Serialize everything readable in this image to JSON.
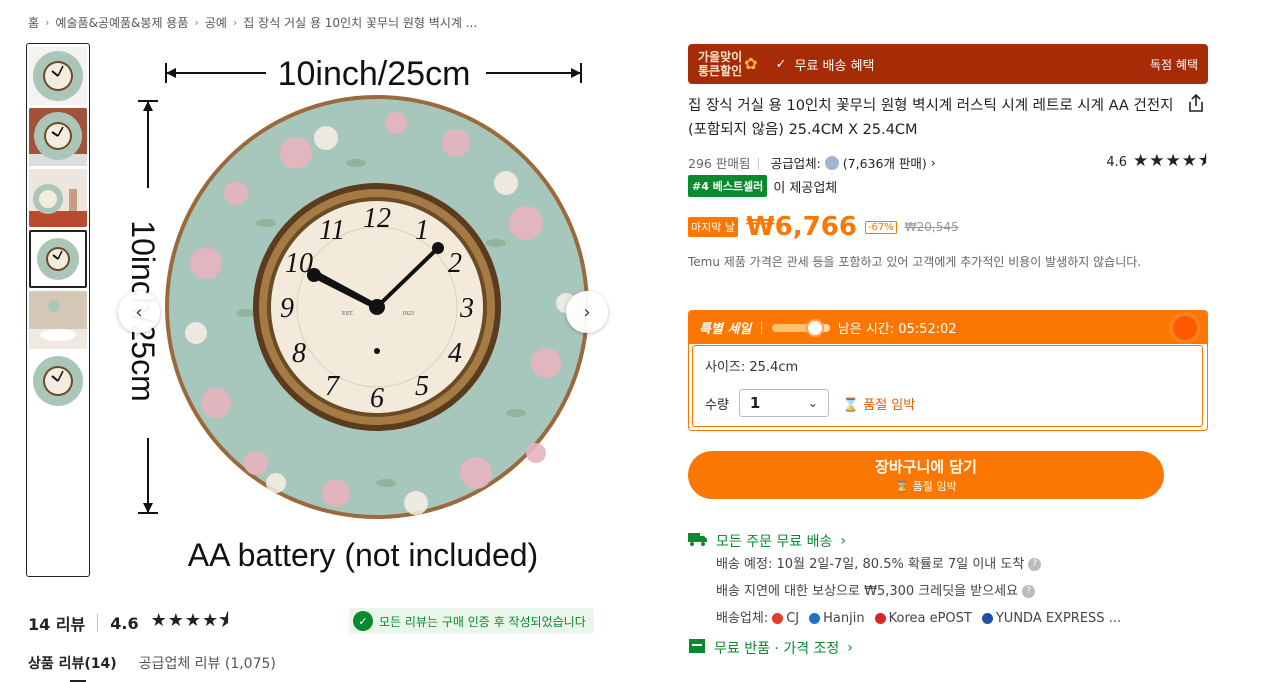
{
  "breadcrumb": [
    "홈",
    "예술품&공예품&봉제 용품",
    "공예",
    "집 장식 거실 용 10인치 꽃무늬 원형 벽시계 ..."
  ],
  "image": {
    "dimension_top": "10inch/25cm",
    "dimension_side": "10inch/25cm",
    "caption": "AA battery (not included)",
    "clock_brand": "EST.",
    "clock_year": "1923",
    "clock_numbers": [
      "12",
      "1",
      "2",
      "3",
      "4",
      "5",
      "6",
      "7",
      "8",
      "9",
      "10",
      "11"
    ]
  },
  "reviews": {
    "count_label": "14 리뷰",
    "rating": "4.6",
    "stars": "★★★★⯨",
    "verified_text": "모든 리뷰는 구매 인증 후 작성되었습니다",
    "tab_product": "상품 리뷰(14)",
    "tab_supplier": "공급업체 리뷰 (1,075)"
  },
  "promo": {
    "badge_line1": "가을맞이",
    "badge_line2": "통큰할인",
    "main": "무료 배송 혜택",
    "right": "독점 혜택"
  },
  "product": {
    "title": "집 장식 거실 용 10인치 꽃무늬 원형 벽시계 러스틱 시계 레트로 시계 AA 건전지 (포함되지 않음) 25.4CM X 25.4CM",
    "sold": "296 판매됨",
    "supplier_label": "공급업체:",
    "supplier_sales": "(7,636개 판매)",
    "rating": "4.6",
    "stars": "★★★★⯨",
    "bestseller_tag": "#4 베스트셀러",
    "bestseller_text": "이 제공업체"
  },
  "price": {
    "last_tag": "마지막 날",
    "current": "₩6,766",
    "discount": "-67%",
    "original": "₩20,545",
    "notice": "Temu 제품 가격은 관세 등을 포함하고 있어 고객에게 추가적인 비용이 발생하지 않습니다."
  },
  "sale": {
    "label": "특별 세일",
    "remaining": "남은 시간: 05:52:02",
    "progress": 0.75,
    "size": "사이즈: 25.4cm",
    "qty_label": "수량",
    "qty_value": "1",
    "low_stock": "품절 임박"
  },
  "cart": {
    "label": "장바구니에 담기",
    "sub": "품절 임박"
  },
  "shipping": {
    "title": "모든 주문 무료 배송",
    "eta": "배송 예정: 10월 2일-7일, 80.5% 확률로 7일 이내 도착",
    "delay": "배송 지연에 대한 보상으로 ₩5,300 크레딧을 받으세요",
    "carriers_label": "배송업체:",
    "carriers": [
      "CJ",
      "Hanjin",
      "Korea ePOST",
      "YUNDA EXPRESS ..."
    ],
    "return_title": "무료 반품 · 가격 조정"
  },
  "colors": {
    "accent": "#fb7701",
    "promo": "#a62b07",
    "green": "#0a8a2e"
  }
}
